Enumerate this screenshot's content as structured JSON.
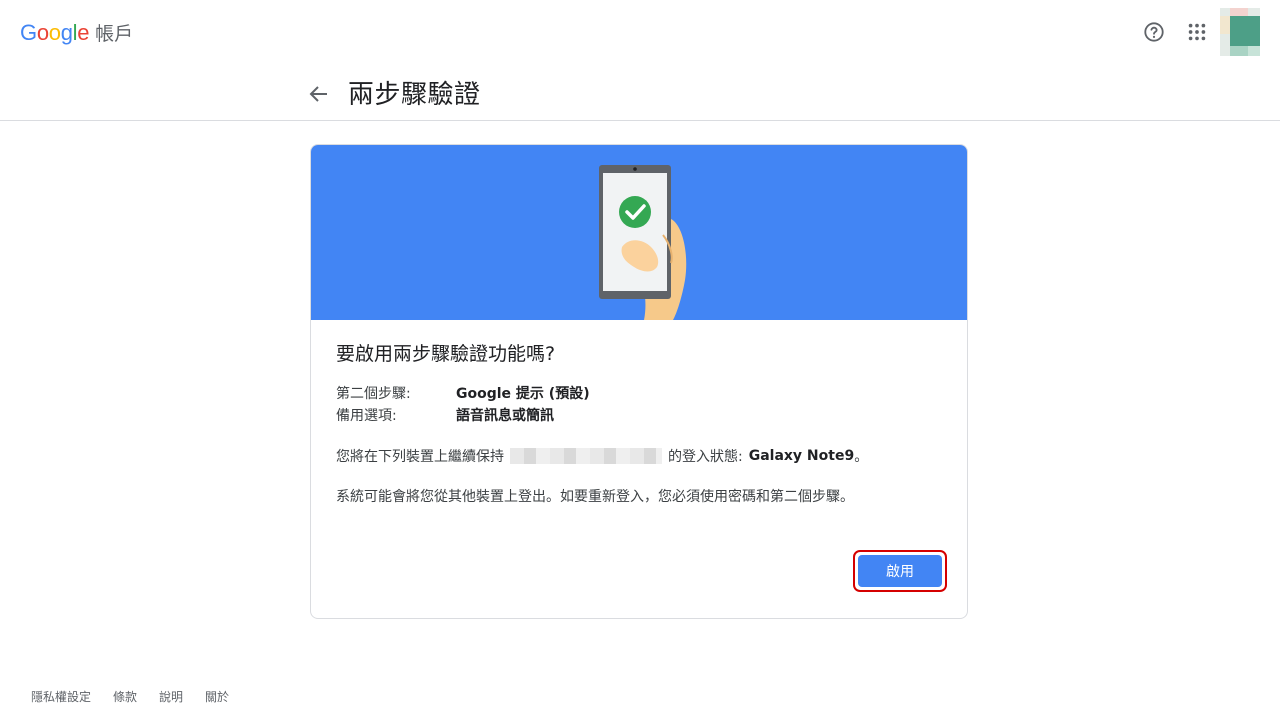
{
  "header": {
    "logo_letters": [
      "G",
      "o",
      "o",
      "g",
      "l",
      "e"
    ],
    "product_name": "帳戶",
    "icons": [
      "help-icon",
      "apps-grid-icon",
      "account-avatar"
    ]
  },
  "page": {
    "back_icon": "arrow-back-icon",
    "title": "兩步驟驗證"
  },
  "card": {
    "banner_color": "#4285F4",
    "title": "要啟用兩步驟驗證功能嗎?",
    "rows": [
      {
        "label": "第二個步驟:",
        "value": "Google 提示 (預設)"
      },
      {
        "label": "備用選項:",
        "value": "語音訊息或簡訊"
      }
    ],
    "device_text_before": "您將在下列裝置上繼續保持",
    "device_text_after": "的登入狀態:",
    "device_name": "Galaxy Note9",
    "device_period": "。",
    "signout_text": "系統可能會將您從其他裝置上登出。如要重新登入，您必須使用密碼和第二個步驟。",
    "enable_button": "啟用",
    "button_color": "#4285F4",
    "highlight_color": "#d50000"
  },
  "footer": {
    "links": [
      "隱私權設定",
      "條款",
      "說明",
      "關於"
    ]
  }
}
